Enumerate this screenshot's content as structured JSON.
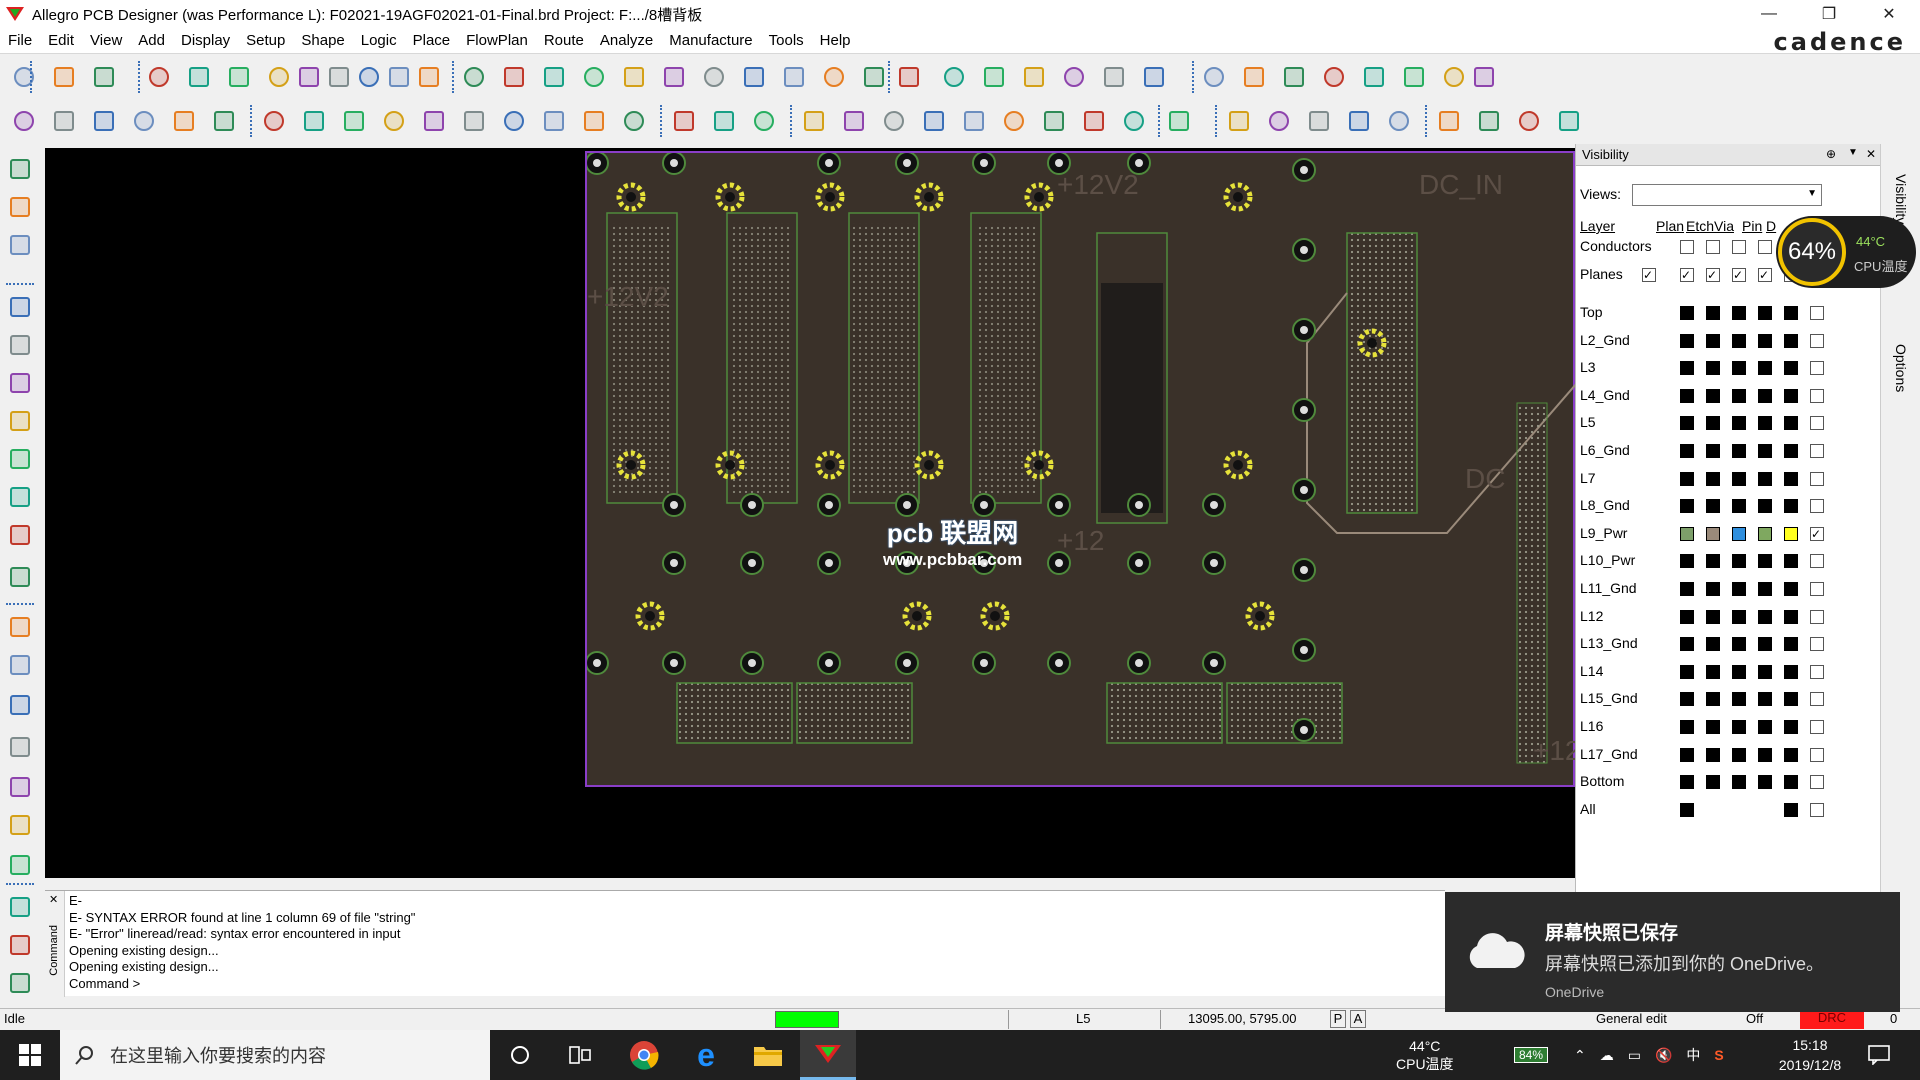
{
  "window": {
    "title": "Allegro PCB Designer (was Performance L): F02021-19AGF02021-01-Final.brd  Project: F:.../8槽背板",
    "minimize": "—",
    "restore": "❐",
    "close": "✕"
  },
  "menu": [
    "File",
    "Edit",
    "View",
    "Add",
    "Display",
    "Setup",
    "Shape",
    "Logic",
    "Place",
    "FlowPlan",
    "Route",
    "Analyze",
    "Manufacture",
    "Tools",
    "Help"
  ],
  "brand": "cadence",
  "canvas": {
    "board_labels": [
      "+12V2",
      "+12V2",
      "DC_IN",
      "+12",
      "DC",
      "+12"
    ],
    "watermark_line1": "pcb 联盟网",
    "watermark_line2": "www.pcbbar.com"
  },
  "visibility": {
    "panel_title": "Visibility",
    "views_label": "Views:",
    "views_value": "",
    "columns": [
      "Layer",
      "Plan",
      "Etch",
      "Via",
      "Pin",
      "D"
    ],
    "groups": [
      {
        "label": "Conductors",
        "cells": [
          false,
          false,
          false,
          false,
          true
        ]
      },
      {
        "label": "Planes",
        "cells": [
          true,
          true,
          true,
          true,
          true
        ]
      }
    ],
    "layers": [
      {
        "name": "Top",
        "cells": [
          true,
          true,
          true,
          true,
          true,
          false
        ]
      },
      {
        "name": "L2_Gnd",
        "cells": [
          true,
          true,
          true,
          true,
          true,
          false
        ]
      },
      {
        "name": "L3",
        "cells": [
          true,
          true,
          true,
          true,
          true,
          false
        ]
      },
      {
        "name": "L4_Gnd",
        "cells": [
          true,
          true,
          true,
          true,
          true,
          false
        ]
      },
      {
        "name": "L5",
        "cells": [
          true,
          true,
          true,
          true,
          true,
          false
        ]
      },
      {
        "name": "L6_Gnd",
        "cells": [
          true,
          true,
          true,
          true,
          true,
          false
        ]
      },
      {
        "name": "L7",
        "cells": [
          true,
          true,
          true,
          true,
          true,
          false
        ]
      },
      {
        "name": "L8_Gnd",
        "cells": [
          true,
          true,
          true,
          true,
          true,
          false
        ]
      },
      {
        "name": "L9_Pwr",
        "cells": [
          "#7d9f6a",
          "#9a8a7a",
          "#2f8fde",
          "#7fa860",
          "#ffff20",
          "check"
        ]
      },
      {
        "name": "L10_Pwr",
        "cells": [
          true,
          true,
          true,
          true,
          true,
          false
        ]
      },
      {
        "name": "L11_Gnd",
        "cells": [
          true,
          true,
          true,
          true,
          true,
          false
        ]
      },
      {
        "name": "L12",
        "cells": [
          true,
          true,
          true,
          true,
          true,
          false
        ]
      },
      {
        "name": "L13_Gnd",
        "cells": [
          true,
          true,
          true,
          true,
          true,
          false
        ]
      },
      {
        "name": "L14",
        "cells": [
          true,
          true,
          true,
          true,
          true,
          false
        ]
      },
      {
        "name": "L15_Gnd",
        "cells": [
          true,
          true,
          true,
          true,
          true,
          false
        ]
      },
      {
        "name": "L16",
        "cells": [
          true,
          true,
          true,
          true,
          true,
          false
        ]
      },
      {
        "name": "L17_Gnd",
        "cells": [
          true,
          true,
          true,
          true,
          true,
          false
        ]
      },
      {
        "name": "Bottom",
        "cells": [
          true,
          true,
          true,
          true,
          true,
          false
        ]
      },
      {
        "name": "All",
        "cells": [
          true,
          null,
          null,
          null,
          true,
          false
        ]
      }
    ],
    "side_tabs": [
      "Visibility",
      "Options"
    ]
  },
  "cpu": {
    "percent": "64%",
    "temp": "44°C",
    "label": "CPU温度"
  },
  "console": {
    "lines": [
      "E-",
      "E- SYNTAX ERROR found at line 1 column 69 of file \"string\"",
      "E- \"Error\" lineread/read: syntax error encountered in input",
      "Opening existing design...",
      "Opening existing design...",
      "Command >"
    ],
    "side_label": "Command"
  },
  "status": {
    "state": "Idle",
    "layer": "L5",
    "coords": "13095.00, 5795.00",
    "p_btn": "P",
    "a_btn": "A",
    "mode": "General edit",
    "off": "Off",
    "drc": "DRC",
    "count": "0"
  },
  "toast": {
    "title": "屏幕快照已保存",
    "body": "屏幕快照已添加到你的 OneDrive。",
    "app": "OneDrive"
  },
  "taskbar": {
    "search_placeholder": "在这里输入你要搜索的内容",
    "cpu_temp": "44°C",
    "cpu_label": "CPU温度",
    "battery": "84%",
    "ime": "中",
    "time": "15:18",
    "date": "2019/12/8"
  },
  "colors": {
    "board": "#3a3129",
    "board_outline": "#8a3ec8",
    "copper_green": "#4f8a3c",
    "pad_yellow": "#e6e23a",
    "drc_red": "#ff1a1a",
    "status_green": "#00ff00"
  }
}
